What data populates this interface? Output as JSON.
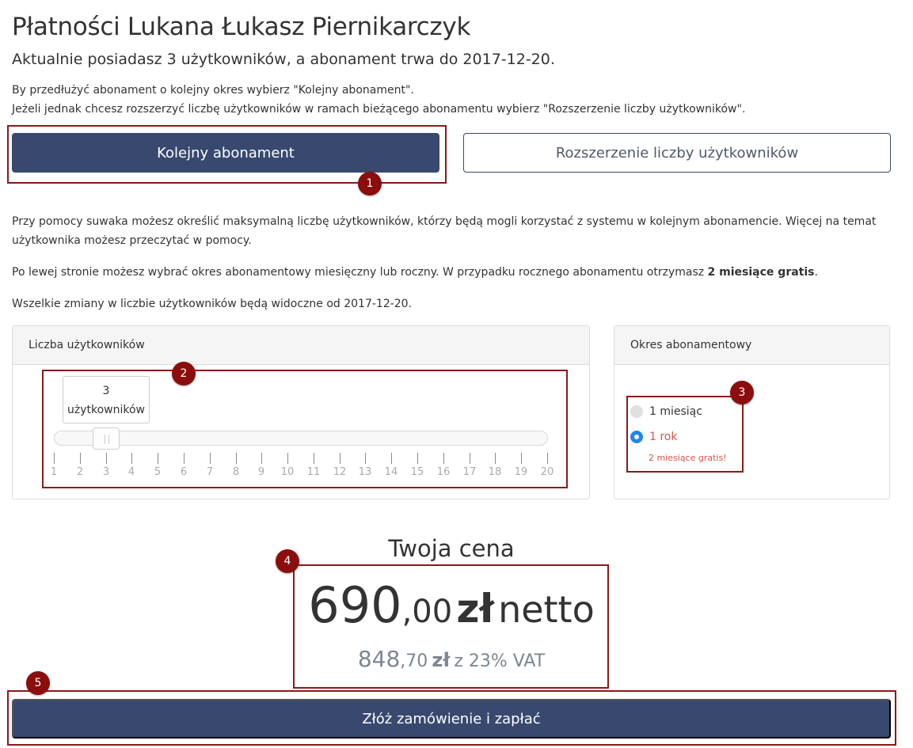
{
  "header": {
    "title": "Płatności Lukana Łukasz Piernikarczyk",
    "subtitle": "Aktualnie posiadasz 3 użytkowników, a abonament trwa do 2017-12-20.",
    "info_line_1": "By przedłużyć abonament o kolejny okres wybierz \"Kolejny abonament\".",
    "info_line_2": "Jeżeli jednak chcesz rozszerzyć liczbę użytkowników w ramach bieżącego abonamentu wybierz \"Rozszerzenie liczby użytkowników\"."
  },
  "options": {
    "next_subscription_label": "Kolejny abonament",
    "extend_users_label": "Rozszerzenie liczby użytkowników"
  },
  "description": {
    "slider_info": "Przy pomocy suwaka możesz określić maksymalną liczbę użytkowników, którzy będą mogli korzystać z systemu w kolejnym abonamencie. Więcej na temat użytkownika możesz przeczytać w pomocy.",
    "period_info_prefix": "Po lewej stronie możesz wybrać okres abonamentowy miesięczny lub roczny. W przypadku rocznego abonamentu otrzymasz ",
    "period_info_bold": "2 miesiące gratis",
    "period_info_suffix": ".",
    "changes_info": "Wszelkie zmiany w liczbie użytkowników będą widoczne od 2017-12-20."
  },
  "users_panel": {
    "heading": "Liczba użytkowników",
    "tooltip_value": "3",
    "tooltip_unit": "użytkowników",
    "selected": 3,
    "min": 1,
    "max": 20,
    "ticks": [
      "1",
      "2",
      "3",
      "4",
      "5",
      "6",
      "7",
      "8",
      "9",
      "10",
      "11",
      "12",
      "13",
      "14",
      "15",
      "16",
      "17",
      "18",
      "19",
      "20"
    ]
  },
  "period_panel": {
    "heading": "Okres abonamentowy",
    "option_month": "1 miesiąc",
    "option_year": "1 rok",
    "selected": "1 rok",
    "year_bonus": "2 miesiące gratis!"
  },
  "price": {
    "heading": "Twoja cena",
    "net_whole": "690",
    "net_decimal": ",00",
    "net_currency": "zł",
    "net_suffix": "netto",
    "gross_whole": "848",
    "gross_decimal": ",70",
    "gross_currency": "zł",
    "gross_suffix": "z 23% VAT"
  },
  "order_button_label": "Złóż zamówienie i zapłać",
  "annotations": {
    "badge_1": "1",
    "badge_2": "2",
    "badge_3": "3",
    "badge_4": "4",
    "badge_5": "5"
  },
  "colors": {
    "primary": "#38486f",
    "highlight": "#8b1a1a",
    "radio_selected": "#1e88e5",
    "bonus_text": "#d9534f"
  }
}
